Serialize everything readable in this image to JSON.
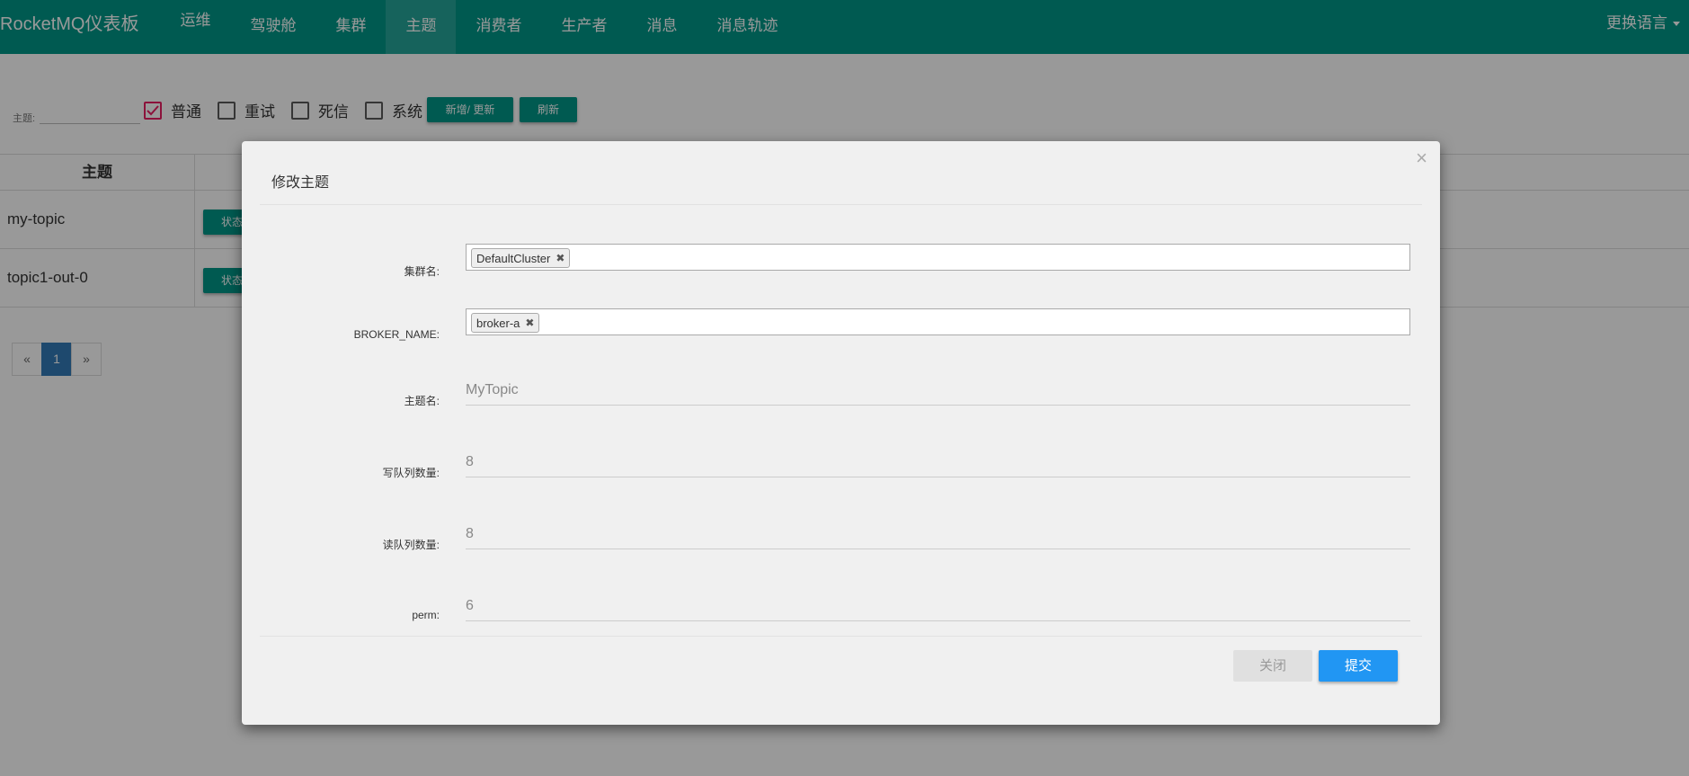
{
  "navbar": {
    "brand": "RocketMQ仪表板",
    "items": [
      {
        "label": "运维"
      },
      {
        "label": "驾驶舱"
      },
      {
        "label": "集群"
      },
      {
        "label": "主题"
      },
      {
        "label": "消费者"
      },
      {
        "label": "生产者"
      },
      {
        "label": "消息"
      },
      {
        "label": "消息轨迹"
      }
    ],
    "active_index": 3,
    "language_label": "更换语言"
  },
  "filter": {
    "topic_label": "主题:",
    "topic_value": "",
    "checkboxes": [
      {
        "label": "普通",
        "checked": true
      },
      {
        "label": "重试",
        "checked": false
      },
      {
        "label": "死信",
        "checked": false
      },
      {
        "label": "系统",
        "checked": false
      }
    ],
    "add_update_label": "新增/ 更新",
    "refresh_label": "刷新"
  },
  "table": {
    "header_topic": "主题",
    "rows": [
      {
        "name": "my-topic",
        "status_label": "状态"
      },
      {
        "name": "topic1-out-0",
        "status_label": "状态"
      }
    ]
  },
  "pagination": {
    "prev": "«",
    "current": "1",
    "next": "»"
  },
  "modal": {
    "title": "修改主题",
    "close_icon": "×",
    "fields": {
      "cluster_label": "集群名:",
      "cluster_tag": "DefaultCluster",
      "broker_label": "BROKER_NAME:",
      "broker_tag": "broker-a",
      "topic_label": "主题名:",
      "topic_value": "MyTopic",
      "write_queue_label": "写队列数量:",
      "write_queue_value": "8",
      "read_queue_label": "读队列数量:",
      "read_queue_value": "8",
      "perm_label": "perm:",
      "perm_value": "6"
    },
    "close_label": "关闭",
    "submit_label": "提交"
  },
  "colors": {
    "navbar": "#009688",
    "submit": "#2196f3",
    "checkbox_checked": "#e91e63"
  }
}
